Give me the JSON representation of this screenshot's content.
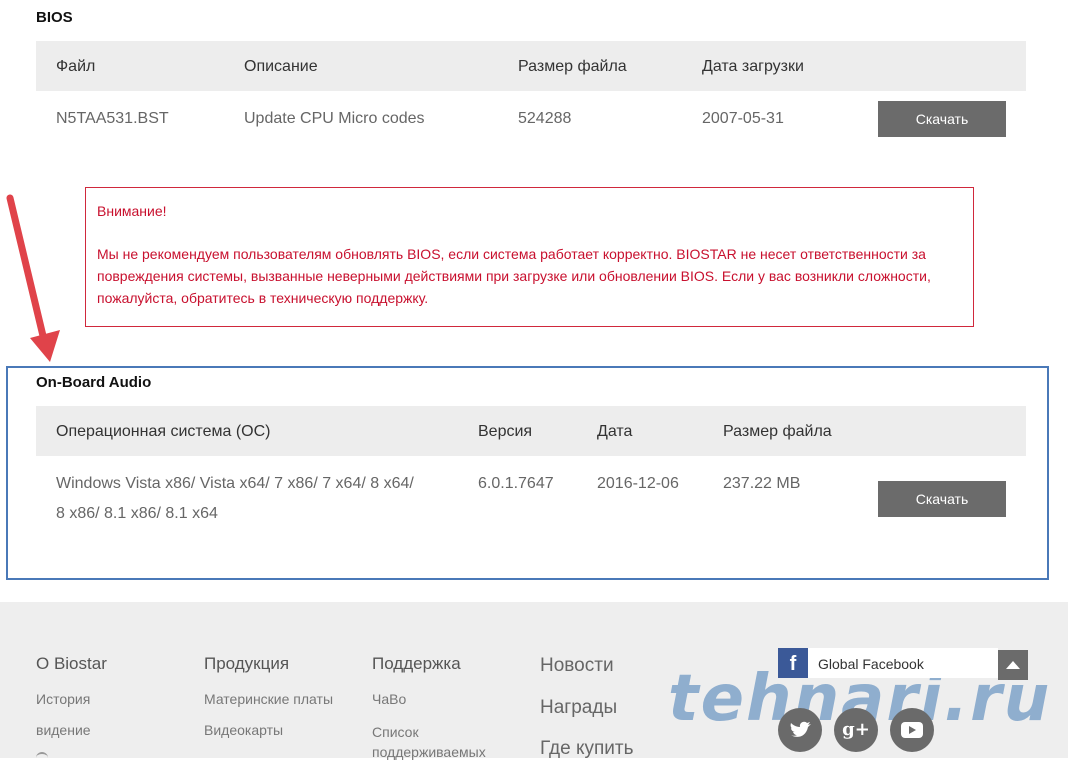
{
  "bios": {
    "title": "BIOS",
    "headers": [
      "Файл",
      "Описание",
      "Размер файла",
      "Дата загрузки"
    ],
    "row": {
      "file": "N5TAA531.BST",
      "description": "Update CPU Micro codes",
      "size": "524288",
      "date": "2007-05-31"
    },
    "download_label": "Скачать"
  },
  "warning": {
    "title": "Внимание!",
    "body": "Мы не рекомендуем пользователям обновлять BIOS, если система работает корректно. BIOSTAR не несет ответственности за повреждения системы, вызванные неверными действиями при загрузке или обновлении BIOS. Если у вас возникли сложности, пожалуйста, обратитесь в техническую поддержку."
  },
  "audio": {
    "title": "On-Board Audio",
    "headers": [
      "Операционная система (ОС)",
      "Версия",
      "Дата",
      "Размер файла"
    ],
    "row": {
      "os_line1": "Windows Vista x86/ Vista x64/ 7 x86/ 7 x64/ 8 x64/",
      "os_line2": "8 x86/ 8.1 x86/ 8.1 x64",
      "version": "6.0.1.7647",
      "date": "2016-12-06",
      "size": "237.22 MB"
    },
    "download_label": "Скачать"
  },
  "footer": {
    "about": {
      "heading": "О Biostar",
      "links": [
        "История",
        "видение"
      ]
    },
    "products": {
      "heading": "Продукция",
      "links": [
        "Материнские платы",
        "Видеокарты"
      ]
    },
    "support": {
      "heading": "Поддержка",
      "links": [
        "ЧаВо",
        "Список поддерживаемых"
      ]
    },
    "big_links": [
      "Новости",
      "Награды",
      "Где купить"
    ],
    "facebook_label": "Global Facebook"
  },
  "watermark": "tehnari.ru",
  "colors": {
    "warning": "#c8102e",
    "highlight": "#4a79b8",
    "button": "#6b6b6b",
    "arrow": "#e0434a",
    "facebook": "#3b5998"
  }
}
